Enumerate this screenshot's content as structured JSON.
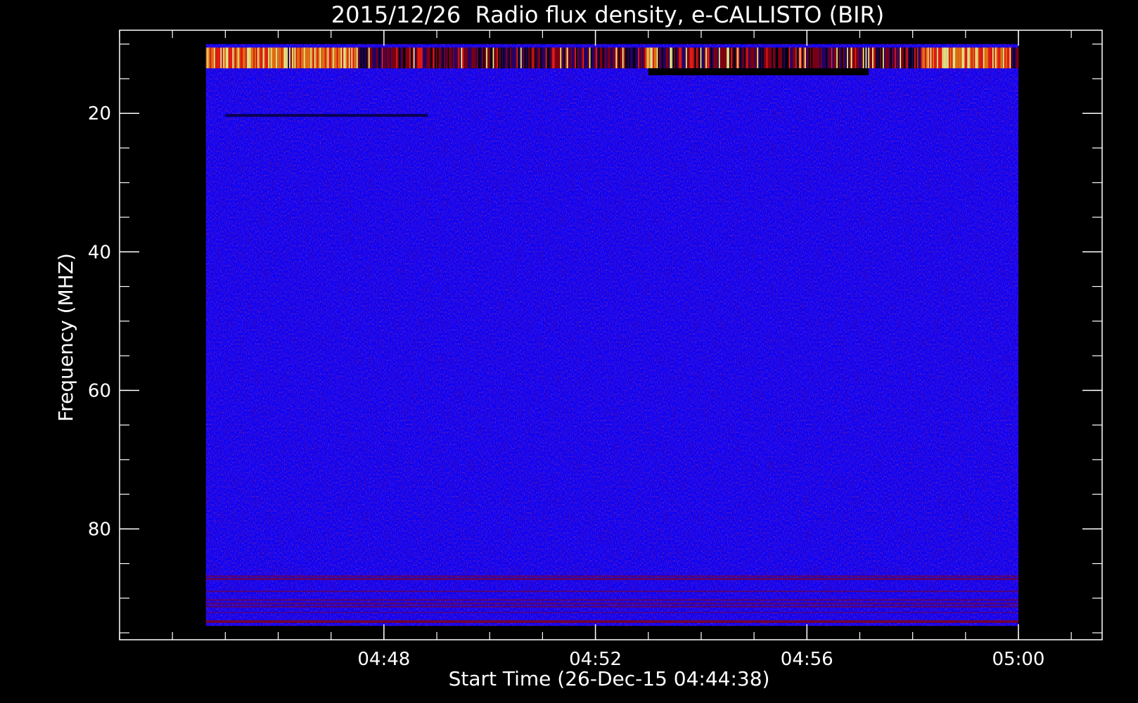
{
  "chart_data": {
    "type": "heatmap",
    "title": "2015/12/26  Radio flux density, e-CALLISTO (BIR)",
    "xlabel": "Start Time (26-Dec-15 04:44:38)",
    "ylabel": "Frequency (MHZ)",
    "x_axis": {
      "unit": "UT time",
      "range": [
        "04:44:38",
        "05:00:00"
      ],
      "plot_range": [
        "04:43:00",
        "05:01:35"
      ],
      "major_ticks": [
        "04:48",
        "04:52",
        "04:56",
        "05:00"
      ],
      "minor_tick_step_minutes": 1
    },
    "y_axis": {
      "unit": "MHz",
      "reversed": true,
      "range": [
        10,
        94
      ],
      "plot_range": [
        8,
        96
      ],
      "major_ticks": [
        20,
        40,
        60,
        80
      ],
      "minor_tick_step": 5
    },
    "grid": false,
    "legend": "none",
    "colormap": [
      "#000000",
      "#2a0060",
      "#0000ff",
      "#8b0000",
      "#ff2000",
      "#ff8000",
      "#ffff80",
      "#ffffff"
    ],
    "background_level_color": "#0000ff",
    "features": [
      {
        "name": "bright band at top of frequency range",
        "frequency_range_mhz": [
          10.5,
          13.5
        ],
        "time_range": [
          "04:44:38",
          "05:00:00"
        ],
        "intensity": "high",
        "strongest_segments": [
          [
            "04:44:38",
            "04:46:10"
          ],
          [
            "04:46:15",
            "04:47:30"
          ],
          [
            "04:52:55",
            "04:53:10"
          ],
          [
            "04:58:10",
            "04:59:50"
          ]
        ]
      },
      {
        "name": "dark horizontal line",
        "frequency_mhz": 20.3,
        "time_range": [
          "04:45:00",
          "04:48:50"
        ],
        "intensity": "low"
      },
      {
        "name": "dark cutoff below the top band",
        "frequency_range_mhz": [
          13.5,
          14.5
        ],
        "time_range": [
          "04:53:00",
          "04:57:10"
        ],
        "intensity": "low"
      },
      {
        "name": "reddish interference lines near bottom of range",
        "frequency_range_mhz": [
          86,
          94
        ],
        "time_range": [
          "04:44:38",
          "05:00:00"
        ],
        "intensity": "medium"
      }
    ]
  }
}
